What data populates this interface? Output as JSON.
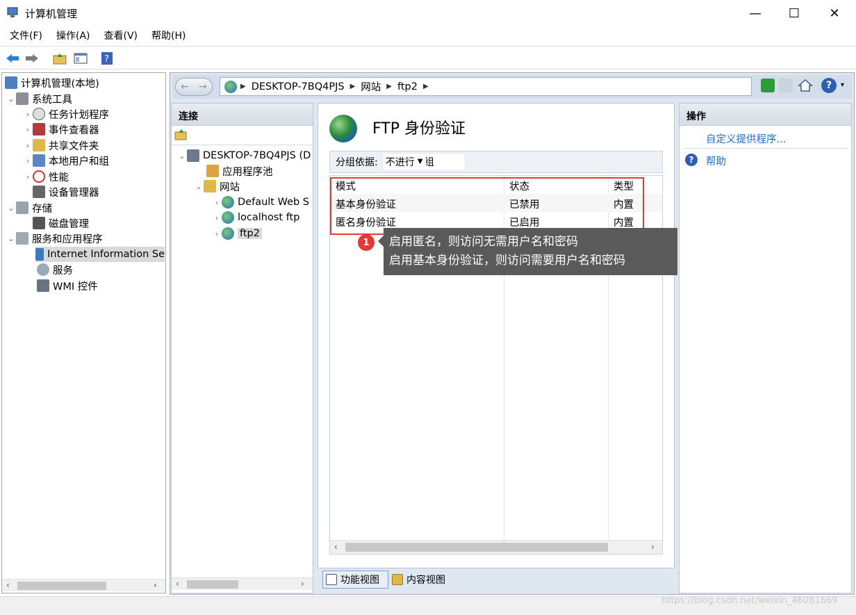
{
  "window": {
    "title": "计算机管理"
  },
  "menu": [
    "文件(F)",
    "操作(A)",
    "查看(V)",
    "帮助(H)"
  ],
  "tree": {
    "root": "计算机管理(本地)",
    "system_tools": "系统工具",
    "task_scheduler": "任务计划程序",
    "event_viewer": "事件查看器",
    "shared_folders": "共享文件夹",
    "local_users": "本地用户和组",
    "performance": "性能",
    "device_manager": "设备管理器",
    "storage": "存储",
    "disk_mgmt": "磁盘管理",
    "services_apps": "服务和应用程序",
    "iis": "Internet Information Se",
    "services": "服务",
    "wmi": "WMI 控件"
  },
  "address": {
    "host": "DESKTOP-7BQ4PJS",
    "sites": "网站",
    "site": "ftp2"
  },
  "connections": {
    "title": "连接",
    "host": "DESKTOP-7BQ4PJS (D",
    "app_pools": "应用程序池",
    "sites": "网站",
    "site1": "Default Web S",
    "site2": "localhost ftp",
    "site3": "ftp2"
  },
  "feature": {
    "title": "FTP 身份验证",
    "group_label": "分组依据:",
    "group_value": "不进行分组",
    "columns": [
      "模式",
      "状态",
      "类型"
    ],
    "rows": [
      [
        "基本身份验证",
        "已禁用",
        "内置"
      ],
      [
        "匿名身份验证",
        "已启用",
        "内置"
      ]
    ]
  },
  "annotation": {
    "number": "1",
    "line1": "启用匿名，则访问无需用户名和密码",
    "line2": "启用基本身份验证，则访问需要用户名和密码"
  },
  "actions": {
    "title": "操作",
    "custom_provider": "自定义提供程序...",
    "help": "帮助"
  },
  "views": {
    "features": "功能视图",
    "content": "内容视图"
  },
  "watermark": "https://blog.csdn.net/weixin_46081669"
}
